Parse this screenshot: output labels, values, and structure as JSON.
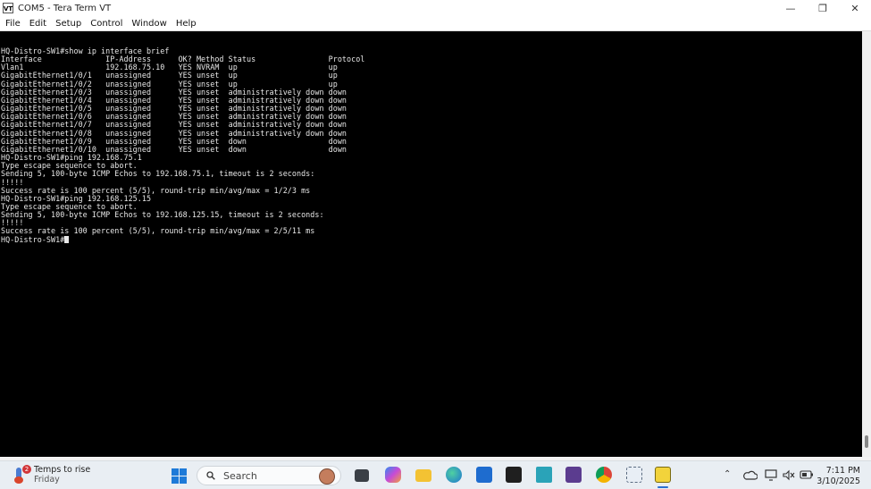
{
  "window": {
    "title": "COM5 - Tera Term VT",
    "app_icon_label": "VT",
    "controls": {
      "minimize": "—",
      "maximize": "❐",
      "close": "✕"
    }
  },
  "menu": [
    "File",
    "Edit",
    "Setup",
    "Control",
    "Window",
    "Help"
  ],
  "terminal": {
    "lines": [
      "HQ-Distro-SW1#show ip interface brief",
      "Interface              IP-Address      OK? Method Status                Protocol",
      "Vlan1                  192.168.75.10   YES NVRAM  up                    up",
      "GigabitEthernet1/0/1   unassigned      YES unset  up                    up",
      "GigabitEthernet1/0/2   unassigned      YES unset  up                    up",
      "GigabitEthernet1/0/3   unassigned      YES unset  administratively down down",
      "GigabitEthernet1/0/4   unassigned      YES unset  administratively down down",
      "GigabitEthernet1/0/5   unassigned      YES unset  administratively down down",
      "GigabitEthernet1/0/6   unassigned      YES unset  administratively down down",
      "GigabitEthernet1/0/7   unassigned      YES unset  administratively down down",
      "GigabitEthernet1/0/8   unassigned      YES unset  administratively down down",
      "GigabitEthernet1/0/9   unassigned      YES unset  down                  down",
      "GigabitEthernet1/0/10  unassigned      YES unset  down                  down",
      "HQ-Distro-SW1#ping 192.168.75.1",
      "Type escape sequence to abort.",
      "Sending 5, 100-byte ICMP Echos to 192.168.75.1, timeout is 2 seconds:",
      "!!!!!",
      "Success rate is 100 percent (5/5), round-trip min/avg/max = 1/2/3 ms",
      "HQ-Distro-SW1#ping 192.168.125.15",
      "Type escape sequence to abort.",
      "Sending 5, 100-byte ICMP Echos to 192.168.125.15, timeout is 2 seconds:",
      "!!!!!",
      "Success rate is 100 percent (5/5), round-trip min/avg/max = 2/5/11 ms"
    ],
    "prompt": "HQ-Distro-SW1#",
    "background": "#000000",
    "foreground": "#e8e8e8"
  },
  "taskbar": {
    "weather": {
      "title": "Temps to rise",
      "subtitle": "Friday",
      "badge": "2"
    },
    "search_placeholder": "Search",
    "apps": [
      "task-view-icon",
      "copilot-icon",
      "file-explorer-icon",
      "edge-icon",
      "store-icon",
      "terminal-icon",
      "visual-studio-icon",
      "visual-studio-2022-icon",
      "chrome-icon",
      "snipping-tool-icon",
      "tera-term-icon"
    ],
    "tray": {
      "chevron": "⌃",
      "icons": [
        "onedrive-icon",
        "display-icon",
        "volume-muted-icon",
        "battery-icon"
      ]
    },
    "clock": {
      "time": "7:11 PM",
      "date": "3/10/2025"
    }
  }
}
